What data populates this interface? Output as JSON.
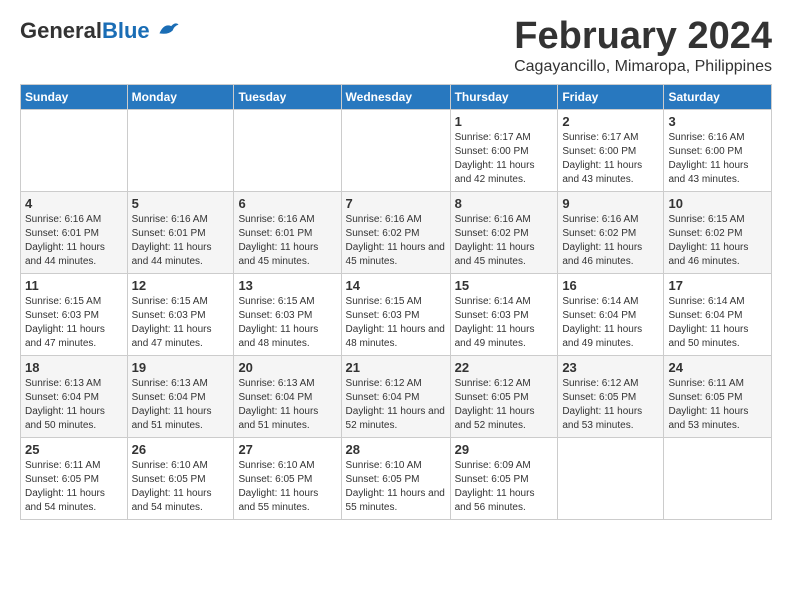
{
  "logo": {
    "general": "General",
    "blue": "Blue"
  },
  "title": {
    "month": "February 2024",
    "location": "Cagayancillo, Mimaropa, Philippines"
  },
  "headers": [
    "Sunday",
    "Monday",
    "Tuesday",
    "Wednesday",
    "Thursday",
    "Friday",
    "Saturday"
  ],
  "weeks": [
    [
      {
        "day": "",
        "detail": ""
      },
      {
        "day": "",
        "detail": ""
      },
      {
        "day": "",
        "detail": ""
      },
      {
        "day": "",
        "detail": ""
      },
      {
        "day": "1",
        "detail": "Sunrise: 6:17 AM\nSunset: 6:00 PM\nDaylight: 11 hours and 42 minutes."
      },
      {
        "day": "2",
        "detail": "Sunrise: 6:17 AM\nSunset: 6:00 PM\nDaylight: 11 hours and 43 minutes."
      },
      {
        "day": "3",
        "detail": "Sunrise: 6:16 AM\nSunset: 6:00 PM\nDaylight: 11 hours and 43 minutes."
      }
    ],
    [
      {
        "day": "4",
        "detail": "Sunrise: 6:16 AM\nSunset: 6:01 PM\nDaylight: 11 hours and 44 minutes."
      },
      {
        "day": "5",
        "detail": "Sunrise: 6:16 AM\nSunset: 6:01 PM\nDaylight: 11 hours and 44 minutes."
      },
      {
        "day": "6",
        "detail": "Sunrise: 6:16 AM\nSunset: 6:01 PM\nDaylight: 11 hours and 45 minutes."
      },
      {
        "day": "7",
        "detail": "Sunrise: 6:16 AM\nSunset: 6:02 PM\nDaylight: 11 hours and 45 minutes."
      },
      {
        "day": "8",
        "detail": "Sunrise: 6:16 AM\nSunset: 6:02 PM\nDaylight: 11 hours and 45 minutes."
      },
      {
        "day": "9",
        "detail": "Sunrise: 6:16 AM\nSunset: 6:02 PM\nDaylight: 11 hours and 46 minutes."
      },
      {
        "day": "10",
        "detail": "Sunrise: 6:15 AM\nSunset: 6:02 PM\nDaylight: 11 hours and 46 minutes."
      }
    ],
    [
      {
        "day": "11",
        "detail": "Sunrise: 6:15 AM\nSunset: 6:03 PM\nDaylight: 11 hours and 47 minutes."
      },
      {
        "day": "12",
        "detail": "Sunrise: 6:15 AM\nSunset: 6:03 PM\nDaylight: 11 hours and 47 minutes."
      },
      {
        "day": "13",
        "detail": "Sunrise: 6:15 AM\nSunset: 6:03 PM\nDaylight: 11 hours and 48 minutes."
      },
      {
        "day": "14",
        "detail": "Sunrise: 6:15 AM\nSunset: 6:03 PM\nDaylight: 11 hours and 48 minutes."
      },
      {
        "day": "15",
        "detail": "Sunrise: 6:14 AM\nSunset: 6:03 PM\nDaylight: 11 hours and 49 minutes."
      },
      {
        "day": "16",
        "detail": "Sunrise: 6:14 AM\nSunset: 6:04 PM\nDaylight: 11 hours and 49 minutes."
      },
      {
        "day": "17",
        "detail": "Sunrise: 6:14 AM\nSunset: 6:04 PM\nDaylight: 11 hours and 50 minutes."
      }
    ],
    [
      {
        "day": "18",
        "detail": "Sunrise: 6:13 AM\nSunset: 6:04 PM\nDaylight: 11 hours and 50 minutes."
      },
      {
        "day": "19",
        "detail": "Sunrise: 6:13 AM\nSunset: 6:04 PM\nDaylight: 11 hours and 51 minutes."
      },
      {
        "day": "20",
        "detail": "Sunrise: 6:13 AM\nSunset: 6:04 PM\nDaylight: 11 hours and 51 minutes."
      },
      {
        "day": "21",
        "detail": "Sunrise: 6:12 AM\nSunset: 6:04 PM\nDaylight: 11 hours and 52 minutes."
      },
      {
        "day": "22",
        "detail": "Sunrise: 6:12 AM\nSunset: 6:05 PM\nDaylight: 11 hours and 52 minutes."
      },
      {
        "day": "23",
        "detail": "Sunrise: 6:12 AM\nSunset: 6:05 PM\nDaylight: 11 hours and 53 minutes."
      },
      {
        "day": "24",
        "detail": "Sunrise: 6:11 AM\nSunset: 6:05 PM\nDaylight: 11 hours and 53 minutes."
      }
    ],
    [
      {
        "day": "25",
        "detail": "Sunrise: 6:11 AM\nSunset: 6:05 PM\nDaylight: 11 hours and 54 minutes."
      },
      {
        "day": "26",
        "detail": "Sunrise: 6:10 AM\nSunset: 6:05 PM\nDaylight: 11 hours and 54 minutes."
      },
      {
        "day": "27",
        "detail": "Sunrise: 6:10 AM\nSunset: 6:05 PM\nDaylight: 11 hours and 55 minutes."
      },
      {
        "day": "28",
        "detail": "Sunrise: 6:10 AM\nSunset: 6:05 PM\nDaylight: 11 hours and 55 minutes."
      },
      {
        "day": "29",
        "detail": "Sunrise: 6:09 AM\nSunset: 6:05 PM\nDaylight: 11 hours and 56 minutes."
      },
      {
        "day": "",
        "detail": ""
      },
      {
        "day": "",
        "detail": ""
      }
    ]
  ]
}
